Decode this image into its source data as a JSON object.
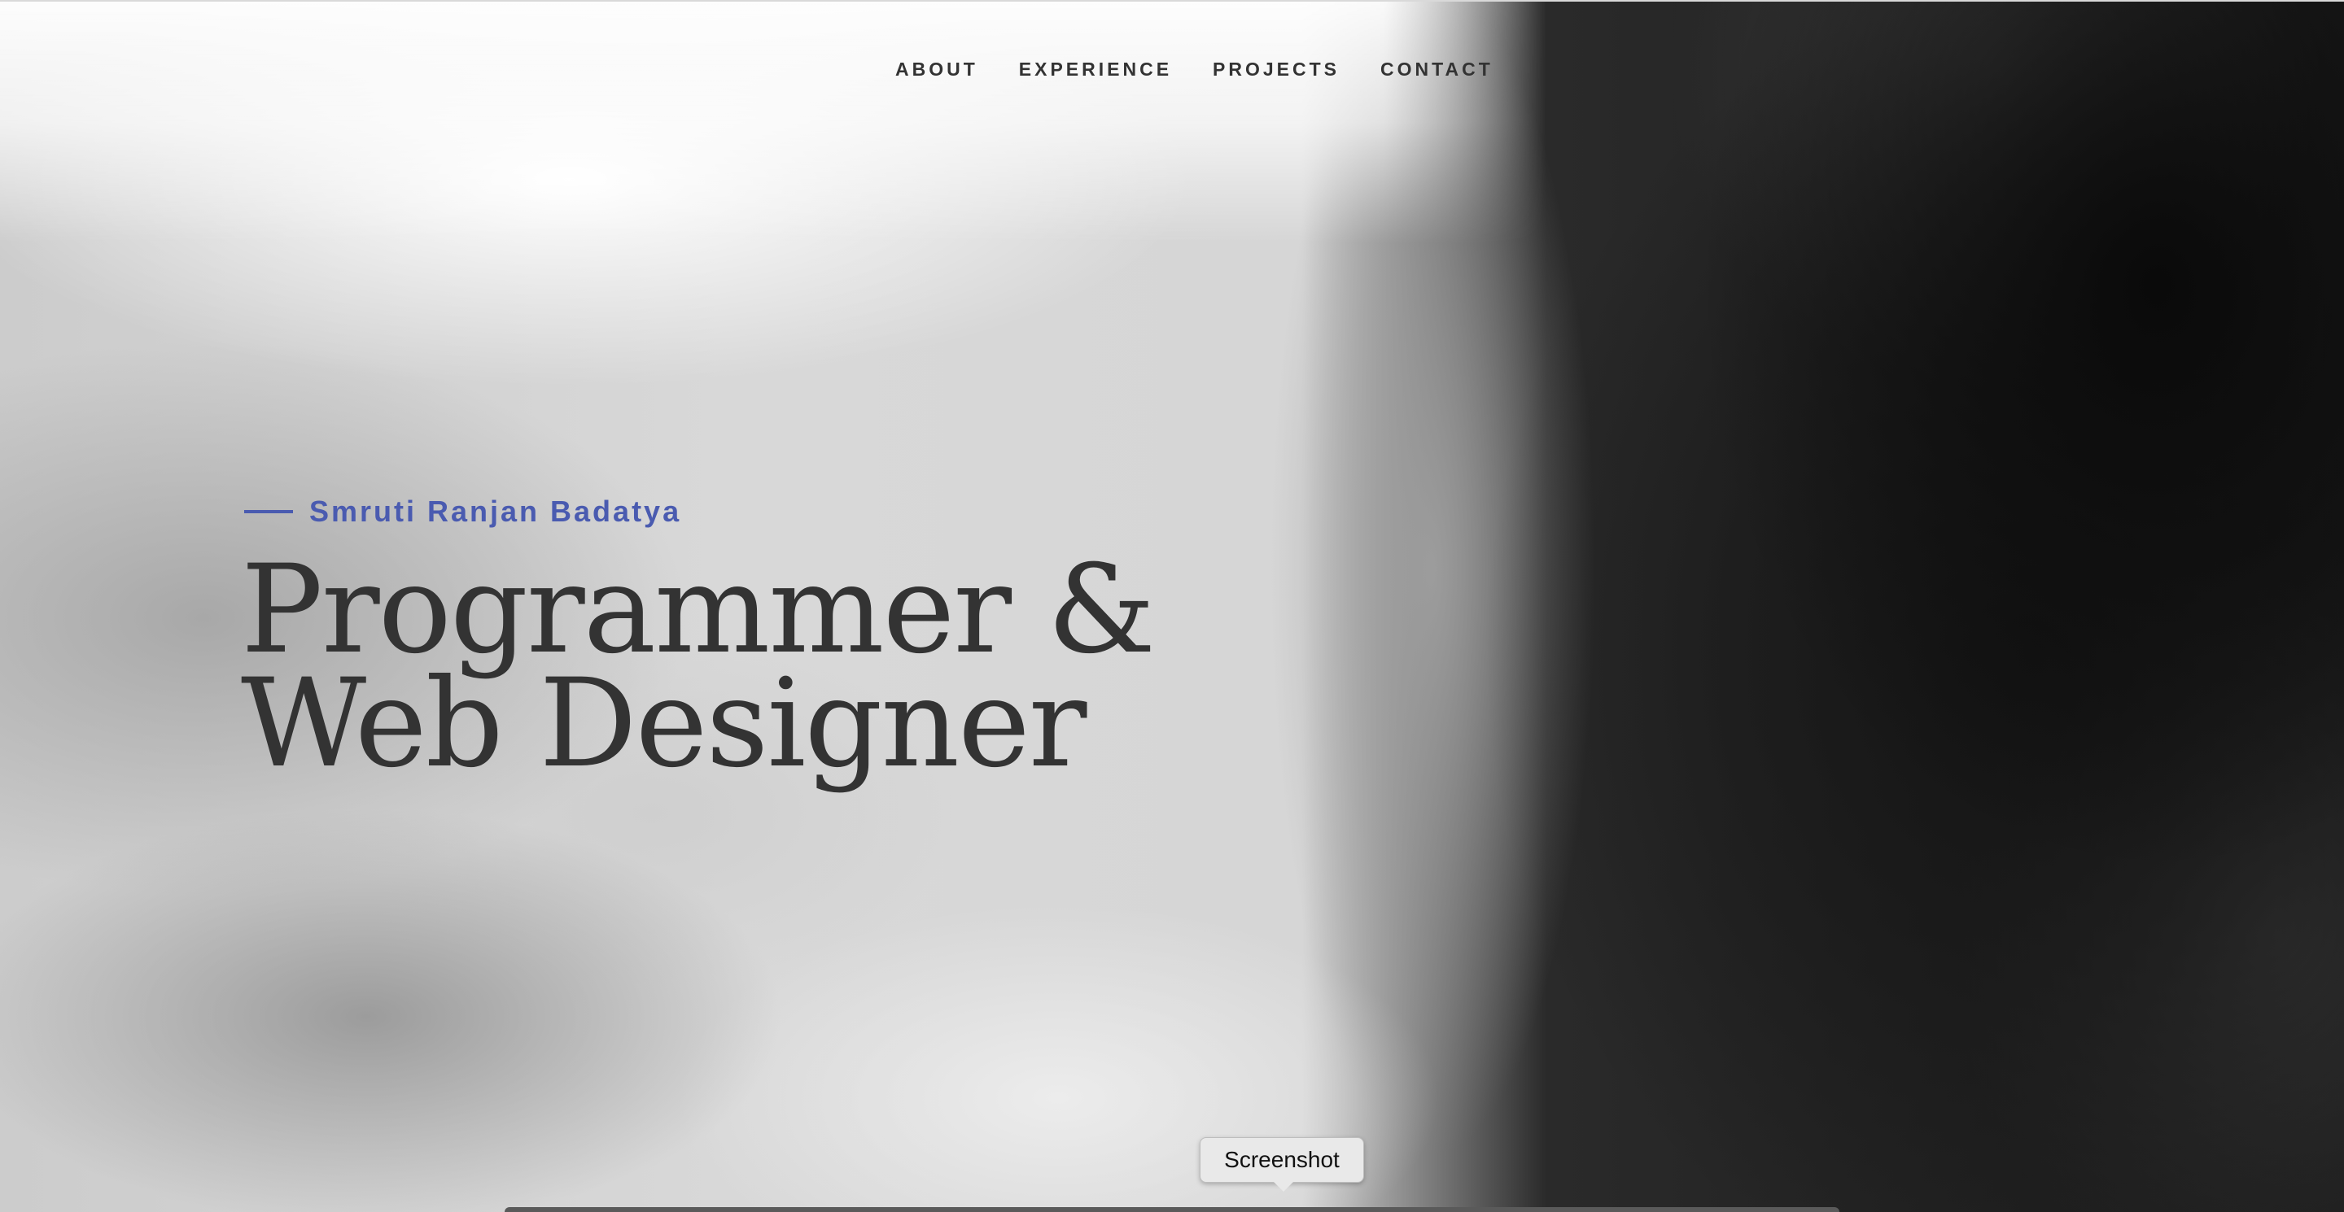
{
  "nav": {
    "items": [
      {
        "label": "ABOUT"
      },
      {
        "label": "EXPERIENCE"
      },
      {
        "label": "PROJECTS"
      },
      {
        "label": "CONTACT"
      }
    ]
  },
  "hero": {
    "name": "Smruti Ranjan Badatya",
    "headline_line1": "Programmer &",
    "headline_line2": "Web Designer"
  },
  "tooltip": {
    "label": "Screenshot"
  },
  "colors": {
    "accent": "#4a5bb0",
    "text": "#333333"
  }
}
